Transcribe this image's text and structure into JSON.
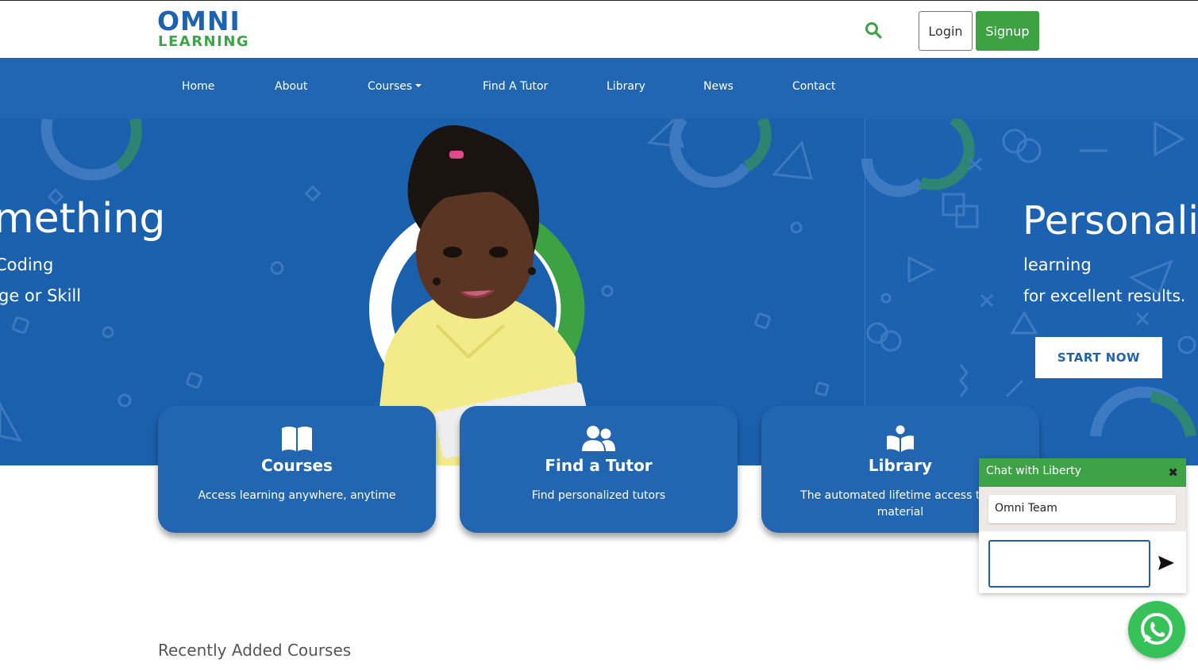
{
  "header": {
    "logo_top": "OMNI",
    "logo_bottom": "LEARNING",
    "login_label": "Login",
    "signup_label": "Signup",
    "search_icon": "search-icon",
    "colors": {
      "brand_blue": "#2166b3",
      "brand_green": "#3da342"
    }
  },
  "nav": {
    "items": [
      {
        "label": "Home"
      },
      {
        "label": "About"
      },
      {
        "label": "Courses"
      },
      {
        "label": "Find A Tutor"
      },
      {
        "label": "Library"
      },
      {
        "label": "News"
      },
      {
        "label": "Contact"
      }
    ]
  },
  "hero": {
    "left_slide": {
      "title": "mething",
      "line1": "Coding",
      "line2": "ge or Skill"
    },
    "right_slide": {
      "title": "Personali",
      "line1": "learning",
      "line2": "for excellent results.",
      "cta_label": "START NOW"
    }
  },
  "cards": [
    {
      "icon": "book-open-icon",
      "title": "Courses",
      "desc": "Access learning anywhere, anytime"
    },
    {
      "icon": "users-icon",
      "title": "Find a Tutor",
      "desc": "Find personalized tutors"
    },
    {
      "icon": "book-reader-icon",
      "title": "Library",
      "desc": "The automated lifetime access to le material"
    }
  ],
  "recent_title": "Recently Added Courses",
  "chat": {
    "title": "Chat with Liberty",
    "close_symbol": "✖",
    "message": "Omni Team",
    "input_value": "",
    "send_icon": "send-icon"
  },
  "whatsapp_icon": "whatsapp-icon"
}
